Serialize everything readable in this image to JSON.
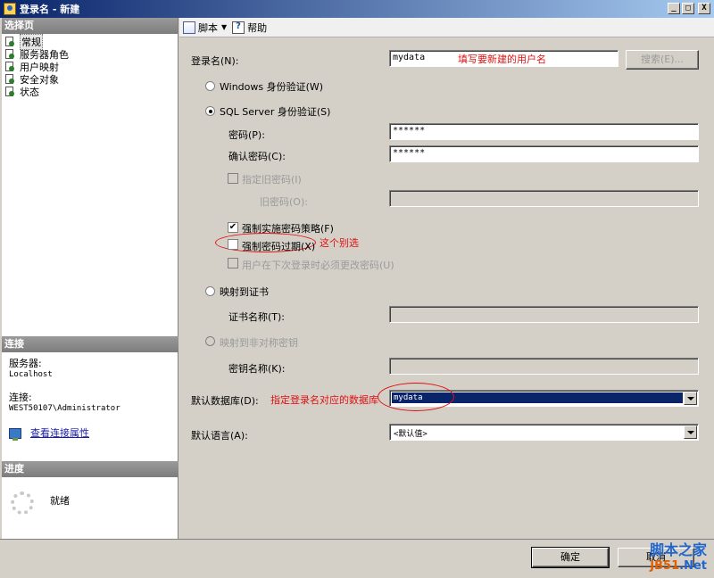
{
  "window": {
    "title": "登录名 - 新建",
    "buttons": [
      "_",
      "□",
      "X"
    ]
  },
  "left_pane": {
    "select_page_header": "选择页",
    "pages": [
      {
        "label": "常规",
        "selected": true
      },
      {
        "label": "服务器角色"
      },
      {
        "label": "用户映射"
      },
      {
        "label": "安全对象"
      },
      {
        "label": "状态"
      }
    ],
    "connection": {
      "header": "连接",
      "server_label": "服务器:",
      "server_value": "Localhost",
      "conn_label": "连接:",
      "conn_value": "WEST50107\\Administrator",
      "view_props_link": "查看连接属性"
    },
    "progress": {
      "header": "进度",
      "status": "就绪"
    }
  },
  "toolbar": {
    "script_label": "脚本",
    "help_label": "帮助"
  },
  "form": {
    "login_name_label": "登录名(N):",
    "login_name_value": "mydata",
    "search_button": "搜索(E)...",
    "windows_auth": "Windows 身份验证(W)",
    "sql_auth": "SQL Server 身份验证(S)",
    "password_label": "密码(P):",
    "password_value": "******",
    "confirm_password_label": "确认密码(C):",
    "confirm_password_value": "******",
    "specify_old_password": "指定旧密码(I)",
    "old_password_label": "旧密码(O):",
    "enforce_policy": "强制实施密码策略(F)",
    "enforce_expiration": "强制密码过期(X)",
    "must_change": "用户在下次登录时必须更改密码(U)",
    "map_to_cert": "映射到证书",
    "cert_name_label": "证书名称(T):",
    "map_to_asym_key": "映射到非对称密钥",
    "key_name_label": "密钥名称(K):",
    "default_db_label": "默认数据库(D):",
    "default_db_value": "mydata",
    "default_lang_label": "默认语言(A):",
    "default_lang_value": "<默认值>"
  },
  "annotations": {
    "login_name_note": "填写要新建的用户名",
    "expiration_note": "这个别选",
    "default_db_note": "指定登录名对应的数据库"
  },
  "footer": {
    "ok_button": "确定",
    "cancel_button": "取消"
  },
  "watermark": {
    "line1": "脚本之家",
    "line2_a": "JB51",
    "line2_b": ".Net"
  },
  "colors": {
    "annotation": "#e01010",
    "selection": "#0a246a",
    "link": "#1a1aa6"
  }
}
